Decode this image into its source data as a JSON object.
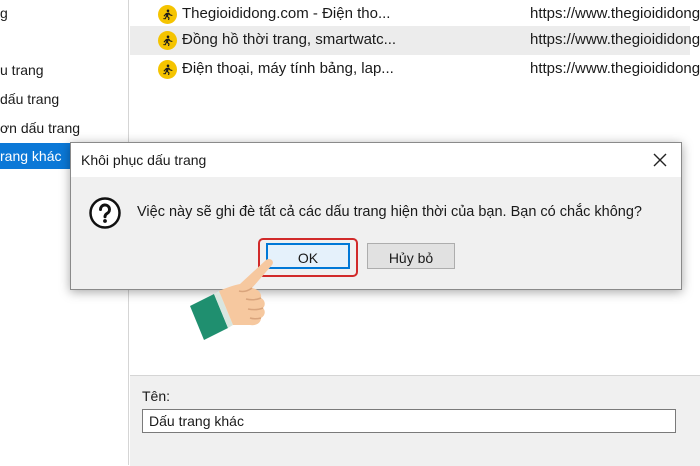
{
  "sidebar": {
    "items": [
      {
        "label": "g"
      },
      {
        "label": "u trang"
      },
      {
        "label": "dấu trang"
      },
      {
        "label": "ơn dấu trang"
      },
      {
        "label": "rang khác"
      }
    ]
  },
  "bookmarks": {
    "rows": [
      {
        "title": "Thegioididong.com - Điện tho...",
        "url": "https://www.thegioididong"
      },
      {
        "title": "Đồng hồ thời trang, smartwatc...",
        "url": "https://www.thegioididong"
      },
      {
        "title": "Điện thoại, máy tính bảng, lap...",
        "url": "https://www.thegioididong"
      }
    ]
  },
  "name_panel": {
    "label": "Tên:",
    "value": "Dấu trang khác"
  },
  "dialog": {
    "title": "Khôi phục dấu trang",
    "message": "Việc này sẽ ghi đè tất cả các dấu trang hiện thời của bạn. Bạn có chắc không?",
    "ok_label": "OK",
    "cancel_label": "Hủy bỏ"
  },
  "colors": {
    "selection": "#0b78d7",
    "favicon": "#f5c400",
    "highlight_ring": "#d12a2a"
  }
}
